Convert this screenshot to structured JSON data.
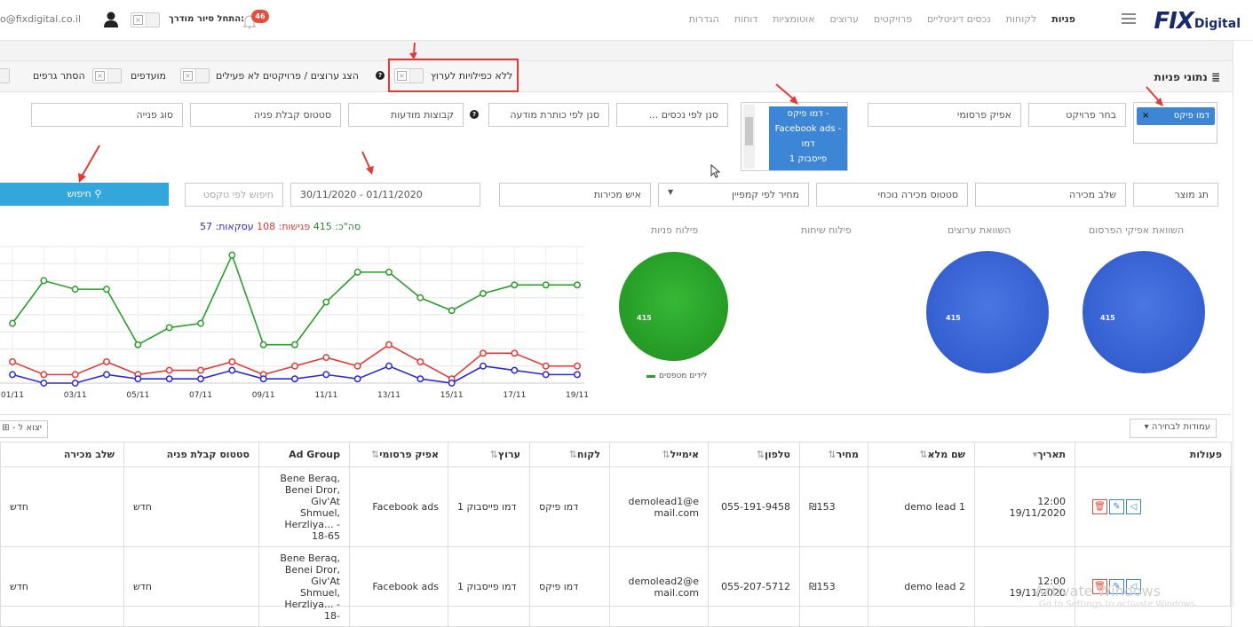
{
  "nav": {
    "brand_fix": "FIX",
    "brand_digital": "Digital",
    "items": [
      "פניות",
      "לקוחות",
      "נכסים דיגיטליים",
      "פרויקטים",
      "ערוצים",
      "אוטומציות",
      "דוחות",
      "הגדרות"
    ],
    "notification_count": "46",
    "tour_label": "התחל סיור מודרך:",
    "email": "o@fixdigital.co.il"
  },
  "panel": {
    "title": "נתוני פניות",
    "toggles": [
      "ללא כפילויות לערוץ",
      "הצג ערוצים / פרויקטים לא פעילים",
      "מועדפים",
      "הסתר גרפים"
    ]
  },
  "filters": {
    "row1": {
      "project_chip": "דמו פיקס",
      "choose_project": "בחר פרויקט",
      "ad_platform": "אפיק פרסומי",
      "channel_options": [
        "דמו פיקס - Facebook ads - דמו",
        "פייסבוק 1"
      ],
      "filter_assets": "סנן לפי נכסים ...",
      "filter_title": "סנן לפי כותרת מודעה",
      "ad_groups": "קבוצות מודעות",
      "lead_status": "סטטוס קבלת פניה",
      "lead_type": "סוג פנייה"
    },
    "row2": {
      "product_tag": "תג מוצר",
      "sales_stage": "שלב מכירה",
      "current_status": "סטטוס מכירה נוכחי",
      "campaign_price": "מחיר לפי קמפיין",
      "salesperson": "איש מכירות",
      "date_range": "30/11/2020 - 01/11/2020",
      "text_search": "חיפוש לפי טקסט",
      "search_button": "חיפוש"
    }
  },
  "stats": {
    "summary_prefix": "סה\"כ:",
    "total": "415",
    "meetings_label": "פגישות:",
    "meetings": "108",
    "deals_label": "עסקאות:",
    "deals": "57"
  },
  "pies": {
    "titles": [
      "השוואת אפיקי הפרסום",
      "השוואת ערוצים",
      "פילוח שיחות",
      "פילוח פניות"
    ],
    "value": "415",
    "legend": "לידים מטפסים",
    "colors": {
      "blue": "#3b67d6",
      "green": "#2aa12a"
    }
  },
  "chart_data": {
    "type": "line",
    "x": [
      "01/11",
      "02/11",
      "03/11",
      "04/11",
      "05/11",
      "06/11",
      "07/11",
      "08/11",
      "09/11",
      "10/11",
      "11/11",
      "12/11",
      "13/11",
      "14/11",
      "15/11",
      "16/11",
      "17/11",
      "18/11",
      "19/11"
    ],
    "x_tick_labels": [
      "01/11",
      "03/11",
      "05/11",
      "07/11",
      "09/11",
      "11/11",
      "13/11",
      "15/11",
      "17/11",
      "19/11"
    ],
    "ylim": [
      0,
      32
    ],
    "grid": true,
    "series": [
      {
        "color": "#2a9d2a",
        "values": [
          14,
          24,
          22,
          22,
          9,
          13,
          14,
          30,
          9,
          9,
          19,
          26,
          26,
          20,
          17,
          21,
          23,
          23,
          23
        ]
      },
      {
        "color": "#e53935",
        "values": [
          5,
          2,
          2,
          5,
          2,
          3,
          3,
          5,
          2,
          4,
          6,
          4,
          9,
          5,
          1,
          7,
          7,
          4,
          4
        ]
      },
      {
        "color": "#2b2bd4",
        "values": [
          2,
          0,
          0,
          2,
          1,
          1,
          1,
          3,
          1,
          1,
          2,
          1,
          4,
          1,
          0,
          4,
          3,
          2,
          2
        ]
      }
    ]
  },
  "table": {
    "columns_button": "עמודות לבחירה",
    "export_button": "יצוא ל -",
    "headers": [
      "פעולות",
      "תאריך",
      "שם מלא",
      "מחיר",
      "טלפון",
      "אימייל",
      "לקוח",
      "ערוץ",
      "אפיק פרסומי",
      "Ad Group",
      "סטטוס קבלת פניה",
      "שלב מכירה"
    ],
    "rows": [
      {
        "date": "12:00 19/11/2020",
        "name": "demo lead 1",
        "price": "₪153",
        "phone": "055-191-9458",
        "email": "demolead1@email.com",
        "client": "דמו פיקס",
        "channel": "דמו פייסבוק 1",
        "platform": "Facebook ads",
        "adgroup": "Bene Beraq, Benei Dror, Giv'At Shmuel, Herzliya... - 18-65",
        "status": "חדש",
        "stage": "חדש"
      },
      {
        "date": "12:00 19/11/2020",
        "name": "demo lead 2",
        "price": "₪153",
        "phone": "055-207-5712",
        "email": "demolead2@email.com",
        "client": "דמו פיקס",
        "channel": "דמו פייסבוק 1",
        "platform": "Facebook ads",
        "adgroup": "Bene Beraq, Benei Dror, Giv'At Shmuel, Herzliya... - 18-",
        "status": "חדש",
        "stage": "חדש"
      }
    ]
  },
  "watermark": {
    "line1": "Activate Windows",
    "line2": "Go to Settings to activate Windows."
  }
}
